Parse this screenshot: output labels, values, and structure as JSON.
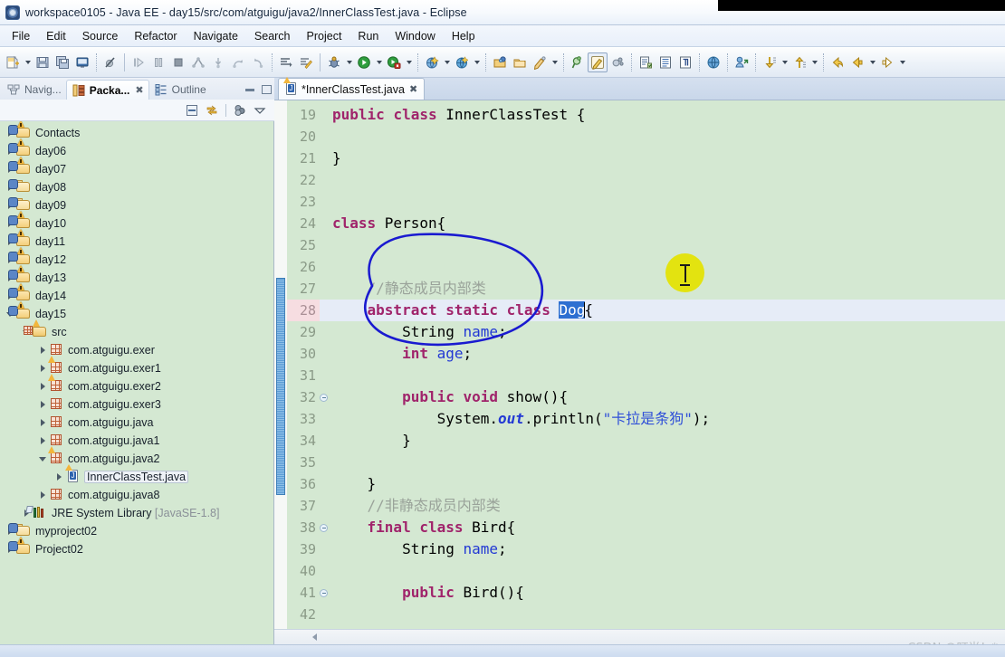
{
  "window": {
    "title": "workspace0105 - Java EE - day15/src/com/atguigu/java2/InnerClassTest.java - Eclipse",
    "app_icon": "eclipse-icon"
  },
  "menubar": {
    "items": [
      "File",
      "Edit",
      "Source",
      "Refactor",
      "Navigate",
      "Search",
      "Project",
      "Run",
      "Window",
      "Help"
    ]
  },
  "toolbar": {
    "groups": [
      {
        "buttons": [
          {
            "name": "new-wizard-icon",
            "glyph": "new",
            "dropdown": true
          },
          {
            "name": "save-icon",
            "glyph": "save"
          },
          {
            "name": "save-all-icon",
            "glyph": "saveall"
          },
          {
            "name": "open-console-icon",
            "glyph": "console"
          }
        ]
      },
      {
        "buttons": [
          {
            "name": "skip-breakpoints-icon",
            "glyph": "skipbp"
          }
        ]
      },
      {
        "buttons": [
          {
            "name": "resume-icon",
            "glyph": "resume"
          },
          {
            "name": "suspend-icon",
            "glyph": "suspend"
          },
          {
            "name": "terminate-icon",
            "glyph": "terminate"
          },
          {
            "name": "disconnect-icon",
            "glyph": "disconnect"
          },
          {
            "name": "step-into-icon",
            "glyph": "stepinto"
          },
          {
            "name": "step-over-icon",
            "glyph": "stepover"
          },
          {
            "name": "step-return-icon",
            "glyph": "stepreturn"
          }
        ]
      },
      {
        "buttons": [
          {
            "name": "next-annotation-icon",
            "glyph": "nextannot"
          },
          {
            "name": "toggle-mark-occurrences-icon",
            "glyph": "markoccur"
          }
        ]
      },
      {
        "buttons": [
          {
            "name": "debug-icon",
            "glyph": "debug",
            "dropdown": true
          },
          {
            "name": "run-icon",
            "glyph": "run",
            "dropdown": true
          },
          {
            "name": "coverage-icon",
            "glyph": "coverage",
            "dropdown": true
          }
        ]
      },
      {
        "buttons": [
          {
            "name": "external-tools-icon",
            "glyph": "exttools",
            "dropdown": true
          },
          {
            "name": "run-on-server-icon",
            "glyph": "server",
            "dropdown": true
          }
        ]
      },
      {
        "buttons": [
          {
            "name": "new-java-package-icon",
            "glyph": "newpkg"
          },
          {
            "name": "new-java-class-icon",
            "glyph": "newclass"
          },
          {
            "name": "new-annotation-icon",
            "glyph": "newannot",
            "dropdown": true
          }
        ]
      },
      {
        "buttons": [
          {
            "name": "search-icon",
            "glyph": "search"
          },
          {
            "name": "highlight-icon",
            "glyph": "highlight",
            "framed": true
          },
          {
            "name": "refresh-icon",
            "glyph": "refresh"
          }
        ]
      },
      {
        "buttons": [
          {
            "name": "open-task-icon",
            "glyph": "opentask"
          },
          {
            "name": "toggle-block-selection-icon",
            "glyph": "blocksel"
          },
          {
            "name": "show-whitespace-icon",
            "glyph": "whitespace"
          }
        ]
      },
      {
        "buttons": [
          {
            "name": "open-web-browser-icon",
            "glyph": "browser"
          }
        ]
      },
      {
        "buttons": [
          {
            "name": "open-type-icon",
            "glyph": "opentype"
          }
        ]
      },
      {
        "buttons": [
          {
            "name": "next-edit-position-icon",
            "glyph": "nextedit",
            "dropdown": true
          },
          {
            "name": "previous-edit-position-icon",
            "glyph": "prevedit",
            "dropdown": true
          }
        ]
      },
      {
        "buttons": [
          {
            "name": "back-history-icon",
            "glyph": "backhist"
          },
          {
            "name": "back-icon",
            "glyph": "back",
            "dropdown": true
          },
          {
            "name": "forward-icon",
            "glyph": "forward",
            "dropdown": true
          }
        ]
      }
    ]
  },
  "left_panel": {
    "tabs": [
      {
        "label": "Navig...",
        "active": false,
        "icon": "navigator-icon",
        "closable": false
      },
      {
        "label": "Packa...",
        "active": true,
        "icon": "package-explorer-icon",
        "closable": true
      },
      {
        "label": "Outline",
        "active": false,
        "icon": "outline-icon",
        "closable": false
      }
    ],
    "window_controls": [
      {
        "name": "minimize-view-button",
        "glyph": "minimize"
      },
      {
        "name": "maximize-view-button",
        "glyph": "maximize"
      }
    ],
    "view_toolbar": [
      {
        "name": "collapse-all-icon",
        "glyph": "collapseall"
      },
      {
        "name": "link-with-editor-icon",
        "glyph": "linkeditor"
      },
      {
        "name": "view-menu-filters-icon",
        "glyph": "filters"
      },
      {
        "name": "view-menu-icon",
        "glyph": "viewmenu"
      }
    ],
    "tree": [
      {
        "label": "Contacts",
        "indent": 0,
        "icon": "java-project-warning",
        "state": "collapsed"
      },
      {
        "label": "day06",
        "indent": 0,
        "icon": "java-project-warning",
        "state": "collapsed"
      },
      {
        "label": "day07",
        "indent": 0,
        "icon": "java-project-warning",
        "state": "collapsed"
      },
      {
        "label": "day08",
        "indent": 0,
        "icon": "project-folder",
        "state": "collapsed"
      },
      {
        "label": "day09",
        "indent": 0,
        "icon": "project-folder",
        "state": "collapsed"
      },
      {
        "label": "day10",
        "indent": 0,
        "icon": "java-project-warning",
        "state": "collapsed"
      },
      {
        "label": "day11",
        "indent": 0,
        "icon": "java-project-warning",
        "state": "collapsed"
      },
      {
        "label": "day12",
        "indent": 0,
        "icon": "java-project-warning",
        "state": "collapsed"
      },
      {
        "label": "day13",
        "indent": 0,
        "icon": "java-project-warning",
        "state": "collapsed"
      },
      {
        "label": "day14",
        "indent": 0,
        "icon": "java-project-warning",
        "state": "collapsed"
      },
      {
        "label": "day15",
        "indent": 0,
        "icon": "java-project-warning",
        "state": "expanded"
      },
      {
        "label": "src",
        "indent": 1,
        "icon": "source-folder-warning",
        "state": "expanded"
      },
      {
        "label": "com.atguigu.exer",
        "indent": 2,
        "icon": "package",
        "state": "collapsed"
      },
      {
        "label": "com.atguigu.exer1",
        "indent": 2,
        "icon": "package-warning",
        "state": "collapsed"
      },
      {
        "label": "com.atguigu.exer2",
        "indent": 2,
        "icon": "package-warning",
        "state": "collapsed"
      },
      {
        "label": "com.atguigu.exer3",
        "indent": 2,
        "icon": "package",
        "state": "collapsed"
      },
      {
        "label": "com.atguigu.java",
        "indent": 2,
        "icon": "package",
        "state": "collapsed"
      },
      {
        "label": "com.atguigu.java1",
        "indent": 2,
        "icon": "package",
        "state": "collapsed"
      },
      {
        "label": "com.atguigu.java2",
        "indent": 2,
        "icon": "package-warning",
        "state": "expanded"
      },
      {
        "label": "InnerClassTest.java",
        "indent": 3,
        "icon": "java-file-warning",
        "state": "collapsed",
        "selected": true
      },
      {
        "label": "com.atguigu.java8",
        "indent": 2,
        "icon": "package",
        "state": "collapsed"
      },
      {
        "label": "JRE System Library",
        "suffix": "[JavaSE-1.8]",
        "indent": 1,
        "icon": "jre-library",
        "state": "collapsed"
      },
      {
        "label": "myproject02",
        "indent": 0,
        "icon": "project-folder",
        "state": "collapsed"
      },
      {
        "label": "Project02",
        "indent": 0,
        "icon": "java-project-warning",
        "state": "collapsed"
      }
    ]
  },
  "editor": {
    "tab": {
      "label": "*InnerClassTest.java",
      "icon": "java-file-warning",
      "close": "✖",
      "dirty": true
    },
    "first_line_number": 19,
    "current_line": 28,
    "fold_markers": [
      28,
      32,
      38,
      41
    ],
    "fold_range": {
      "from": 27,
      "to": 36
    },
    "selection": {
      "line": 28,
      "text": "Dog"
    },
    "lines": [
      {
        "n": 19,
        "tokens": [
          {
            "t": "public ",
            "c": "kw"
          },
          {
            "t": "class ",
            "c": "kw"
          },
          {
            "t": "InnerClassTest {",
            "c": ""
          }
        ]
      },
      {
        "n": 20,
        "tokens": []
      },
      {
        "n": 21,
        "tokens": [
          {
            "t": "}",
            "c": ""
          }
        ]
      },
      {
        "n": 22,
        "tokens": []
      },
      {
        "n": 23,
        "tokens": []
      },
      {
        "n": 24,
        "tokens": [
          {
            "t": "class ",
            "c": "kw"
          },
          {
            "t": "Person{",
            "c": ""
          }
        ]
      },
      {
        "n": 25,
        "tokens": []
      },
      {
        "n": 26,
        "tokens": []
      },
      {
        "n": 27,
        "tokens": [
          {
            "t": "    //静态成员内部类",
            "c": "cmt"
          }
        ]
      },
      {
        "n": 28,
        "tokens": [
          {
            "t": "    ",
            "c": ""
          },
          {
            "t": "abstract static ",
            "c": "kw"
          },
          {
            "t": "class ",
            "c": "kw"
          },
          {
            "t": "Dog",
            "c": "sel"
          },
          {
            "t": "{",
            "c": ""
          }
        ]
      },
      {
        "n": 29,
        "tokens": [
          {
            "t": "        String ",
            "c": ""
          },
          {
            "t": "name",
            "c": "fld"
          },
          {
            "t": ";",
            "c": ""
          }
        ]
      },
      {
        "n": 30,
        "tokens": [
          {
            "t": "        ",
            "c": ""
          },
          {
            "t": "int ",
            "c": "kw"
          },
          {
            "t": "age",
            "c": "fld"
          },
          {
            "t": ";",
            "c": ""
          }
        ]
      },
      {
        "n": 31,
        "tokens": []
      },
      {
        "n": 32,
        "tokens": [
          {
            "t": "        ",
            "c": ""
          },
          {
            "t": "public void ",
            "c": "kw"
          },
          {
            "t": "show(){",
            "c": ""
          }
        ]
      },
      {
        "n": 33,
        "tokens": [
          {
            "t": "            System.",
            "c": ""
          },
          {
            "t": "out",
            "c": "stat"
          },
          {
            "t": ".println(",
            "c": ""
          },
          {
            "t": "\"卡拉是条狗\"",
            "c": "str"
          },
          {
            "t": ");",
            "c": ""
          }
        ]
      },
      {
        "n": 34,
        "tokens": [
          {
            "t": "        }",
            "c": ""
          }
        ]
      },
      {
        "n": 35,
        "tokens": []
      },
      {
        "n": 36,
        "tokens": [
          {
            "t": "    }",
            "c": ""
          }
        ]
      },
      {
        "n": 37,
        "tokens": [
          {
            "t": "    //非静态成员内部类",
            "c": "cmt"
          }
        ]
      },
      {
        "n": 38,
        "tokens": [
          {
            "t": "    ",
            "c": ""
          },
          {
            "t": "final class ",
            "c": "kw"
          },
          {
            "t": "Bird{",
            "c": ""
          }
        ]
      },
      {
        "n": 39,
        "tokens": [
          {
            "t": "        String ",
            "c": ""
          },
          {
            "t": "name",
            "c": "fld"
          },
          {
            "t": ";",
            "c": ""
          }
        ]
      },
      {
        "n": 40,
        "tokens": []
      },
      {
        "n": 41,
        "tokens": [
          {
            "t": "        ",
            "c": ""
          },
          {
            "t": "public ",
            "c": "kw"
          },
          {
            "t": "Bird(){",
            "c": ""
          }
        ]
      },
      {
        "n": 42,
        "tokens": []
      }
    ],
    "annotation": {
      "name": "hand-drawn-circle",
      "color": "#1a1ad0"
    },
    "cursor_indicator": {
      "name": "click-highlight",
      "color": "#e3e310",
      "glyph": "i-beam"
    },
    "hscroll": {
      "left_arrow": "scroll-left-arrow"
    }
  },
  "watermark": {
    "text": "CSDN @叮当！*"
  },
  "colors": {
    "editor_bg": "#d4e8d2",
    "keyword": "#a0246b",
    "string": "#2f4fd8",
    "comment": "#9aa39a",
    "field": "#2238d4",
    "selection": "#2d6fd1",
    "current_line": "#e6ecf7",
    "annotation": "#1a1ad0",
    "click_halo": "#e3e310"
  }
}
